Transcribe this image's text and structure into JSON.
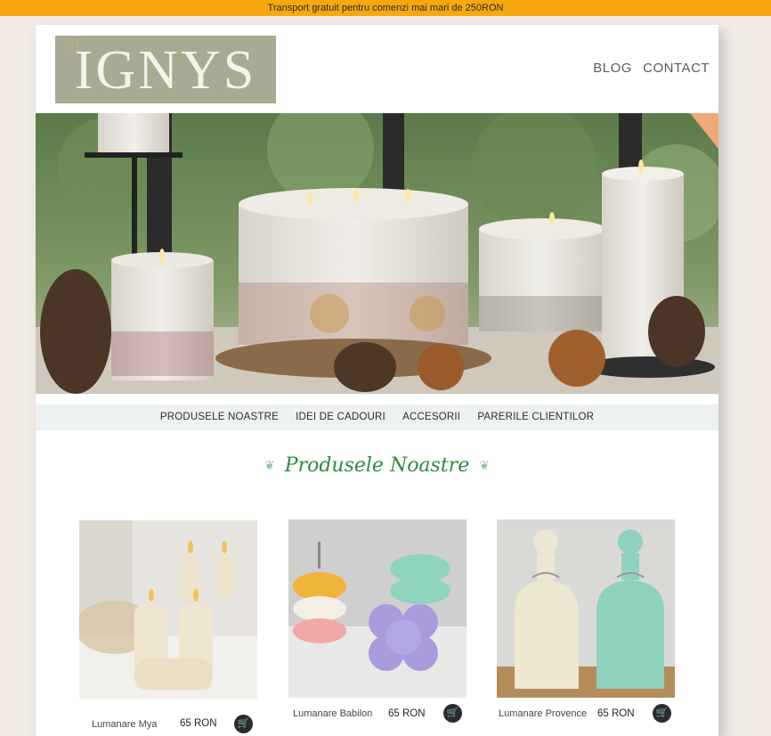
{
  "announcement": "Transport gratuit pentru comenzi mai mari de 250RON",
  "brand": {
    "logo_text": "IGNYS"
  },
  "top_nav": [
    {
      "label": "BLOG"
    },
    {
      "label": "CONTACT"
    }
  ],
  "category_nav": [
    {
      "label": "PRODUSELE NOASTRE"
    },
    {
      "label": "IDEI DE CADOURI"
    },
    {
      "label": "ACCESORII"
    },
    {
      "label": "PARERILE CLIENTILOR"
    }
  ],
  "section_title": "Produsele Noastre",
  "products": [
    {
      "name": "Lumanare Mya",
      "price": "65 RON"
    },
    {
      "name": "Lumanare Babilon",
      "price": "65 RON"
    },
    {
      "name": "Lumanare Provence",
      "price": "65 RON"
    }
  ],
  "colors": {
    "announcement_bg": "#f6a80e",
    "title_green": "#2e8b3e",
    "logo_bg": "#a8aa93"
  },
  "icons": {
    "cart": "cart-icon",
    "leaf": "leaf-icon"
  }
}
